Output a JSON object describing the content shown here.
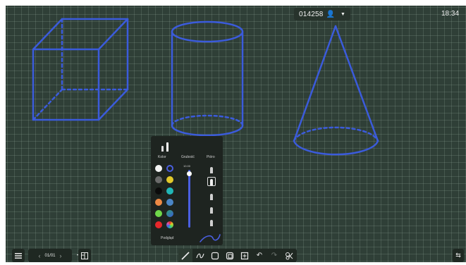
{
  "header": {
    "room_code": "014258",
    "user_icon": "user-icon",
    "dropdown_icon": "caret-down-icon",
    "clock": "18:34"
  },
  "canvas": {
    "stroke_color": "#3b5bdb",
    "shapes": [
      "cube",
      "cylinder",
      "cone"
    ]
  },
  "palette": {
    "labels": {
      "color": "Kolor",
      "thickness": "Grubość",
      "pens": "Pióro"
    },
    "thickness_value": "10.00",
    "colors": [
      "#f4f4f4",
      "#4a5fe0",
      "#6b6b6b",
      "#e2c92b",
      "#0b0b0b",
      "#21b7b7",
      "#ef8a45",
      "#4b86c6",
      "#6fd84a",
      "#2ea36f",
      "#e6272b",
      "#d45ab0"
    ],
    "selected_color": "#4a5fe0",
    "footer_label": "Podgląd"
  },
  "toolbar": {
    "page_indicator": "01/01",
    "menu_icon": "menu-icon",
    "prev_icon": "chevron-left-icon",
    "next_icon": "chevron-right-icon",
    "add_icon": "plus-icon",
    "pages_icon": "pages-icon",
    "tools": [
      "pen",
      "eraser",
      "shape",
      "select",
      "insert",
      "undo",
      "redo",
      "clear"
    ],
    "right_icon": "swap-icon"
  }
}
